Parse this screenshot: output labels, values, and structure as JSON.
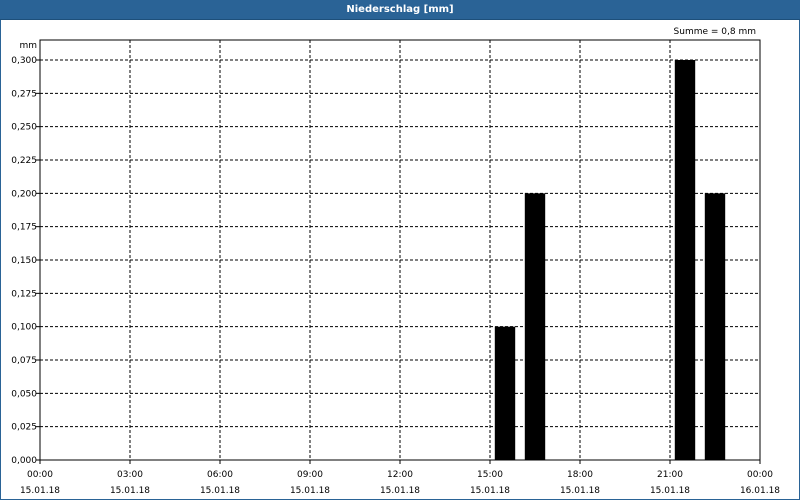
{
  "window": {
    "title": "Niederschlag [mm]"
  },
  "chart_data": {
    "type": "bar",
    "title": "Niederschlag [mm]",
    "ylabel": "mm",
    "annotation": "Summe = 0,8 mm",
    "ylim": [
      0,
      0.3
    ],
    "yticks": [
      "0,000",
      "0,025",
      "0,050",
      "0,075",
      "0,100",
      "0,125",
      "0,150",
      "0,175",
      "0,200",
      "0,225",
      "0,250",
      "0,275",
      "0,300"
    ],
    "xlim_hours": [
      0,
      24
    ],
    "xticks": [
      {
        "time": "00:00",
        "date": "15.01.18"
      },
      {
        "time": "03:00",
        "date": "15.01.18"
      },
      {
        "time": "06:00",
        "date": "15.01.18"
      },
      {
        "time": "09:00",
        "date": "15.01.18"
      },
      {
        "time": "12:00",
        "date": "15.01.18"
      },
      {
        "time": "15:00",
        "date": "15.01.18"
      },
      {
        "time": "18:00",
        "date": "15.01.18"
      },
      {
        "time": "21:00",
        "date": "15.01.18"
      },
      {
        "time": "00:00",
        "date": "16.01.18"
      }
    ],
    "bars": [
      {
        "time": "15:30",
        "value": 0.1
      },
      {
        "time": "16:30",
        "value": 0.2
      },
      {
        "time": "21:30",
        "value": 0.3
      },
      {
        "time": "22:30",
        "value": 0.2
      }
    ]
  }
}
